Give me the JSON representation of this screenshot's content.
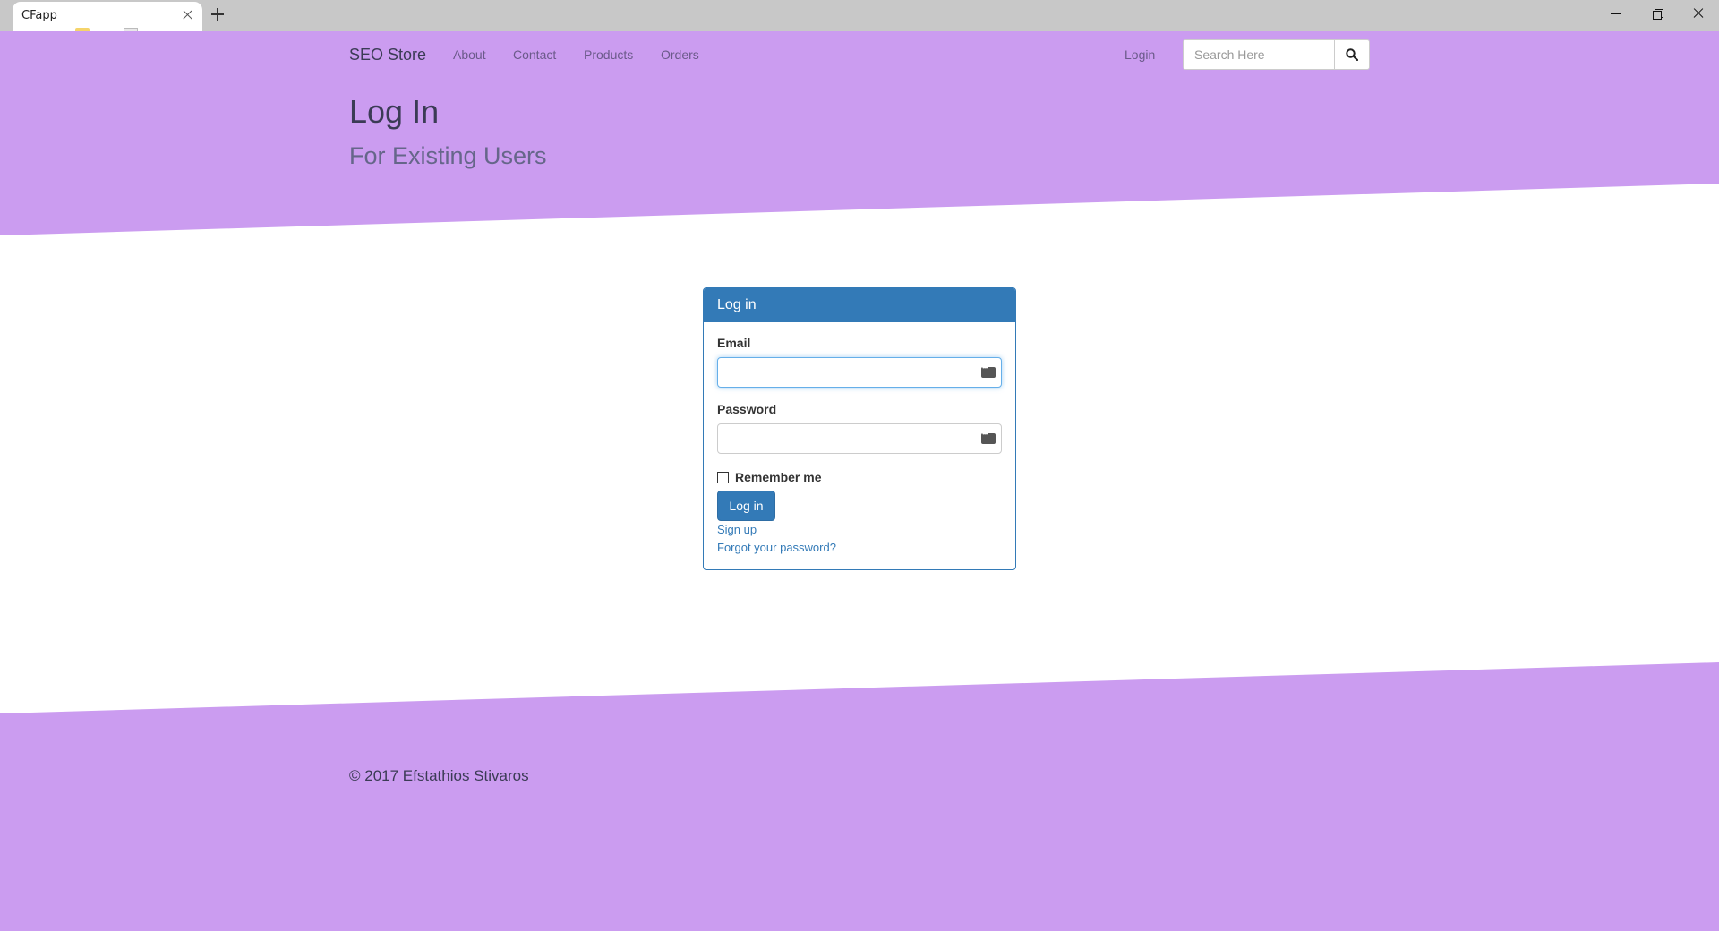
{
  "browser": {
    "tab_title": "CFapp"
  },
  "colors": {
    "accent_purple": "#cb9cf0",
    "panel_blue": "#337ab7"
  },
  "nav": {
    "brand": "SEO Store",
    "links": [
      "About",
      "Contact",
      "Products",
      "Orders"
    ],
    "login": "Login",
    "search_placeholder": "Search Here"
  },
  "hero": {
    "title": "Log In",
    "subtitle": "For Existing Users"
  },
  "login_panel": {
    "heading": "Log in",
    "email_label": "Email",
    "email_value": "",
    "password_label": "Password",
    "password_value": "",
    "remember_label": "Remember me",
    "remember_checked": false,
    "submit_label": "Log in",
    "signup_link": "Sign up",
    "forgot_link": "Forgot your password?"
  },
  "footer": {
    "copyright": "© 2017 Efstathios Stivaros"
  }
}
